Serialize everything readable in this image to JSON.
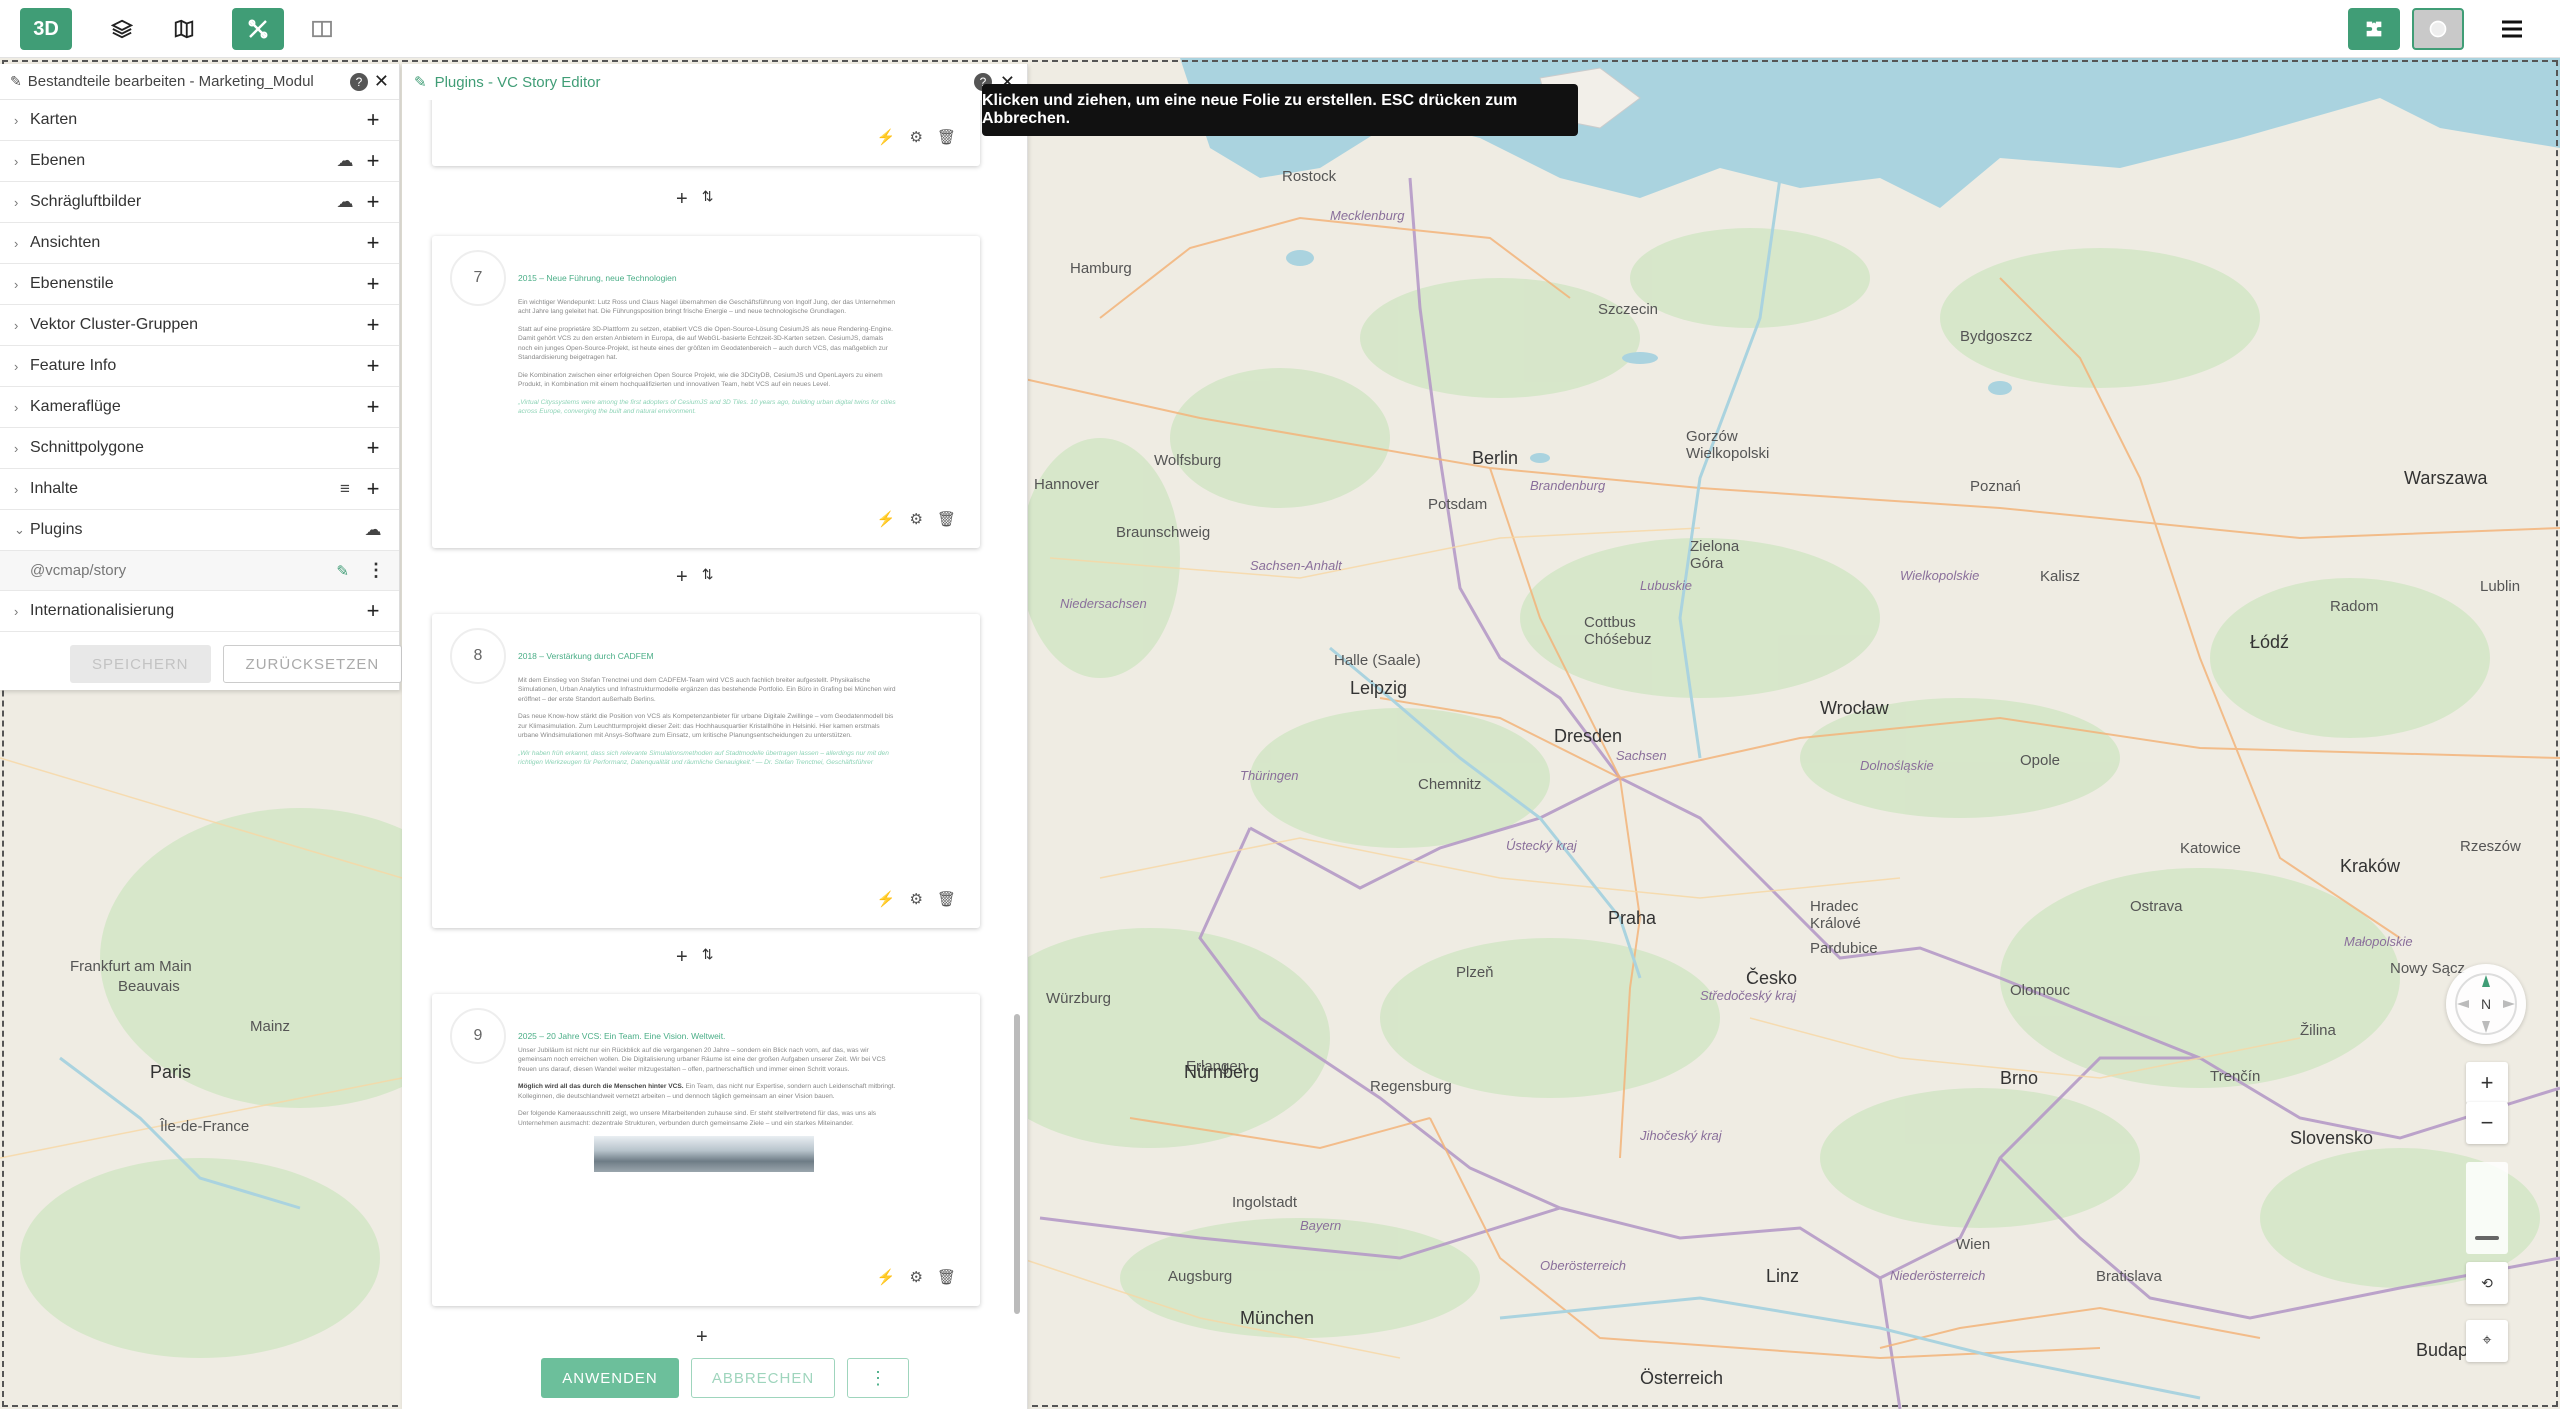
{
  "topbar": {
    "mode_3d_label": "3D"
  },
  "tooltip": {
    "text": "Klicken und ziehen, um eine neue Folie zu erstellen. ESC drücken zum Abbrechen."
  },
  "left_panel": {
    "title": "Bestandteile bearbeiten - Marketing_Modul",
    "items": [
      {
        "label": "Karten"
      },
      {
        "label": "Ebenen"
      },
      {
        "label": "Schrägluftbilder"
      },
      {
        "label": "Ansichten"
      },
      {
        "label": "Ebenenstile"
      },
      {
        "label": "Vektor Cluster-Gruppen"
      },
      {
        "label": "Feature Info"
      },
      {
        "label": "Kameraflüge"
      },
      {
        "label": "Schnittpolygone"
      },
      {
        "label": "Inhalte"
      },
      {
        "label": "Plugins"
      },
      {
        "label": "@vcmap/story"
      },
      {
        "label": "Internationalisierung"
      }
    ],
    "save_label": "SPEICHERN",
    "reset_label": "ZURÜCKSETZEN"
  },
  "editor": {
    "title": "Plugins - VC Story Editor",
    "slides": [
      {
        "number": "7",
        "heading": "2015 – Neue Führung, neue Technologien",
        "p1": "Ein wichtiger Wendepunkt: Lutz Ross und Claus Nagel übernahmen die Geschäftsführung von Ingolf Jung, der das Unternehmen acht Jahre lang geleitet hat. Die Führungsposition bringt frische Energie – und neue technologische Grundlagen.",
        "p2": "Statt auf eine proprietäre 3D-Plattform zu setzen, etabliert VCS die Open-Source-Lösung CesiumJS als neue Rendering-Engine. Damit gehört VCS zu den ersten Anbietern in Europa, die auf WebGL-basierte Echtzeit-3D-Karten setzen. CesiumJS, damals noch ein junges Open-Source-Projekt, ist heute eines der größten im Geodatenbereich – auch durch VCS, das maßgeblich zur Standardisierung beigetragen hat.",
        "p3": "Die Kombination zwischen einer erfolgreichen Open Source Projekt, wie die 3DCityDB, CesiumJS und OpenLayers zu einem Produkt, in Kombination mit einem hochqualifizierten und innovativen Team, hebt VCS auf ein neues Level.",
        "quote": "„Virtual Cityssystems were among the first adopters of CesiumJS and 3D Tiles. 10 years ago, building urban digital twins for cities across Europe, converging the built and natural environment."
      },
      {
        "number": "8",
        "heading": "2018 – Verstärkung durch CADFEM",
        "p1": "Mit dem Einstieg von Stefan Trenctnei und dem CADFEM-Team wird VCS auch fachlich breiter aufgestellt. Physikalische Simulationen, Urban Analytics und Infrastrukturmodelle ergänzen das bestehende Portfolio. Ein Büro in Grafing bei München wird eröffnet – der erste Standort außerhalb Berlins.",
        "p2": "Das neue Know-how stärkt die Position von VCS als Kompetenzanbieter für urbane Digitale Zwillinge – vom Geodatenmodell bis zur Klimasimulation. Zum Leuchtturmprojekt dieser Zeit: das Hochhausquartier Kristallhöhe in Helsinki. Hier kamen erstmals urbane Windsimulationen mit Ansys-Software zum Einsatz, um kritische Planungsentscheidungen zu unterstützen.",
        "quote": "„Wir haben früh erkannt, dass sich relevante Simulationsmethoden auf Stadtmodelle übertragen lassen – allerdings nur mit den richtigen Werkzeugen für Performanz, Datenqualität und räumliche Genauigkeit.“ — Dr. Stefan Trenctnei, Geschäftsführer"
      },
      {
        "number": "9",
        "heading": "2025 – 20 Jahre VCS: Ein Team. Eine Vision. Weltweit.",
        "p1": "Unser Jubiläum ist nicht nur ein Rückblick auf die vergangenen 20 Jahre – sondern ein Blick nach vorn, auf das, was wir gemeinsam noch erreichen wollen. Die Digitalisierung urbaner Räume ist eine der großen Aufgaben unserer Zeit. Wir bei VCS freuen uns darauf, diesen Wandel weiter mitzugestalten – offen, partnerschaftlich und immer einen Schritt voraus.",
        "strong": "Möglich wird all das durch die Menschen hinter VCS.",
        "p2": "Ein Team, das nicht nur Expertise, sondern auch Leidenschaft mitbringt. Kolleginnen, die deutschlandweit vernetzt arbeiten – und dennoch täglich gemeinsam an einer Vision bauen.",
        "p3": "Der folgende Kameraausschnitt zeigt, wo unsere Mitarbeitenden zuhause sind. Er steht stellvertretend für das, was uns als Unternehmen ausmacht: dezentrale Strukturen, verbunden durch gemeinsame Ziele – und ein starkes Miteinander."
      }
    ],
    "apply_label": "ANWENDEN",
    "cancel_label": "ABBRECHEN"
  },
  "map": {
    "cities": [
      {
        "name": "Rostock",
        "major": false
      },
      {
        "name": "Hamburg",
        "major": false
      },
      {
        "name": "Szczecin",
        "major": false
      },
      {
        "name": "Bydgoszcz",
        "major": false
      },
      {
        "name": "Hannover",
        "major": false
      },
      {
        "name": "Wolfsburg",
        "major": false
      },
      {
        "name": "Braunschweig",
        "major": false
      },
      {
        "name": "Berlin",
        "major": true
      },
      {
        "name": "Potsdam",
        "major": false
      },
      {
        "name": "Poznań",
        "major": false
      },
      {
        "name": "Warszawa",
        "major": true
      },
      {
        "name": "Gorzów Wielkopolski",
        "major": false
      },
      {
        "name": "Zielona Góra",
        "major": false
      },
      {
        "name": "Kalisz",
        "major": false
      },
      {
        "name": "Łódź",
        "major": true
      },
      {
        "name": "Halle (Saale)",
        "major": false
      },
      {
        "name": "Leipzig",
        "major": true
      },
      {
        "name": "Cottbus Chóśebuz",
        "major": false
      },
      {
        "name": "Wrocław",
        "major": true
      },
      {
        "name": "Dresden",
        "major": true
      },
      {
        "name": "Chemnitz",
        "major": false
      },
      {
        "name": "Opole",
        "major": false
      },
      {
        "name": "Katowice",
        "major": false
      },
      {
        "name": "Kraków",
        "major": true
      },
      {
        "name": "Praha",
        "major": true
      },
      {
        "name": "Hradec Králové",
        "major": false
      },
      {
        "name": "Pardubice",
        "major": false
      },
      {
        "name": "Ostrava",
        "major": false
      },
      {
        "name": "Würzburg",
        "major": false
      },
      {
        "name": "Plzeň",
        "major": false
      },
      {
        "name": "Erlangen",
        "major": false
      },
      {
        "name": "Nürnberg",
        "major": true
      },
      {
        "name": "Česko",
        "major": true
      },
      {
        "name": "Brno",
        "major": true
      },
      {
        "name": "Slovensko",
        "major": true
      },
      {
        "name": "Regensburg",
        "major": false
      },
      {
        "name": "Ingolstadt",
        "major": false
      },
      {
        "name": "Augsburg",
        "major": false
      },
      {
        "name": "München",
        "major": true
      },
      {
        "name": "Linz",
        "major": true
      },
      {
        "name": "Wien",
        "major": false
      },
      {
        "name": "Bratislava",
        "major": false
      },
      {
        "name": "Budapest",
        "major": true
      },
      {
        "name": "Österreich",
        "major": true
      },
      {
        "name": "Frankfurt am Main",
        "major": false
      },
      {
        "name": "Mainz",
        "major": false
      },
      {
        "name": "Beauvais",
        "major": false
      },
      {
        "name": "Paris",
        "major": true
      },
      {
        "name": "Île-de-France",
        "major": false
      },
      {
        "name": "Radom",
        "major": false
      },
      {
        "name": "Lublin",
        "major": false
      },
      {
        "name": "Rzeszów",
        "major": false
      },
      {
        "name": "Nowy Sącz",
        "major": false
      },
      {
        "name": "Trenčín",
        "major": false
      },
      {
        "name": "Žilina",
        "major": false
      },
      {
        "name": "Olomouc",
        "major": false
      }
    ],
    "regions": [
      {
        "name": "Mecklenburg"
      },
      {
        "name": "Brandenburg"
      },
      {
        "name": "Niedersachsen"
      },
      {
        "name": "Sachsen-Anhalt"
      },
      {
        "name": "Sachsen"
      },
      {
        "name": "Thüringen"
      },
      {
        "name": "Bayern"
      },
      {
        "name": "Jihočeský kraj"
      },
      {
        "name": "Ústecký kraj"
      },
      {
        "name": "Středočeský kraj"
      },
      {
        "name": "Niederösterreich"
      },
      {
        "name": "Oberösterreich"
      },
      {
        "name": "Małopolskie"
      },
      {
        "name": "Lubuskie"
      },
      {
        "name": "Wielkopolskie"
      },
      {
        "name": "Dolnośląskie"
      }
    ],
    "compass_label": "N",
    "accent_color": "#409d76"
  }
}
